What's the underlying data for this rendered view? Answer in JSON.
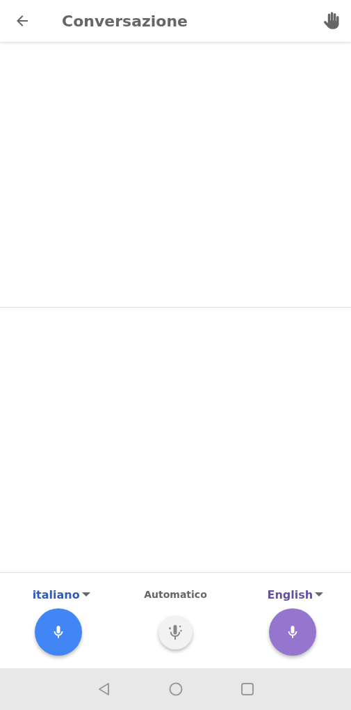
{
  "header": {
    "title": "Conversazione"
  },
  "languages": [
    {
      "label": "italiano",
      "color": "#4285f4"
    },
    {
      "label": "English",
      "color": "#9575cd"
    }
  ],
  "auto": {
    "label": "Automatico"
  }
}
